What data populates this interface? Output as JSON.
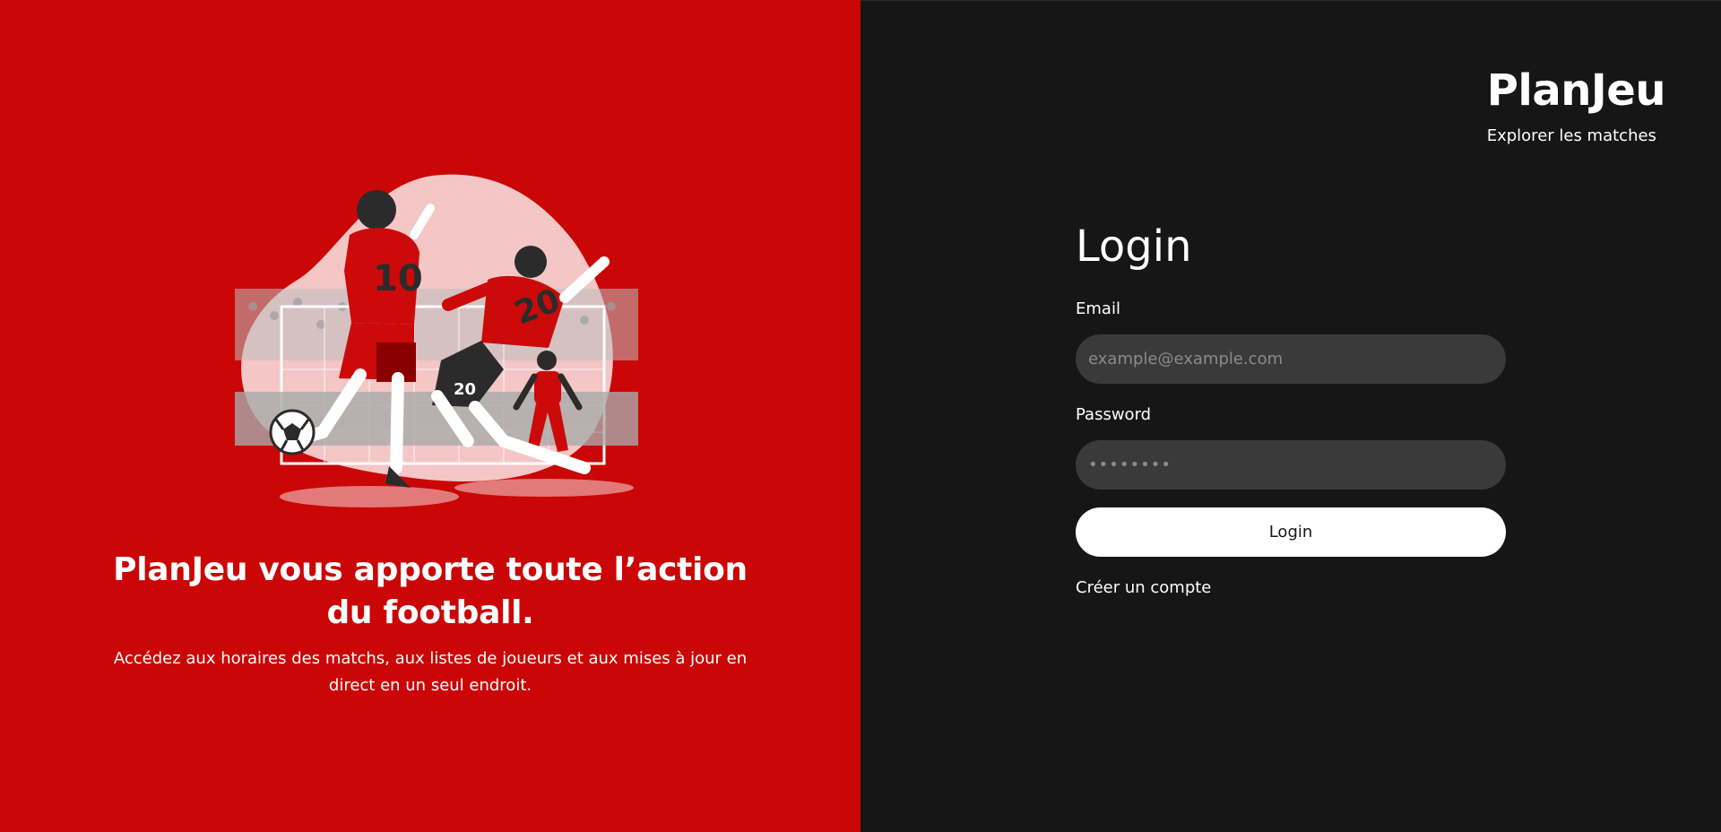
{
  "hero": {
    "title": "PlanJeu vous apporte toute l’action du football.",
    "subtitle": "Accédez aux horaires des matchs, aux listes de joueurs et aux mises à jour en direct en un seul endroit.",
    "illustration": {
      "jersey_numbers": [
        "10",
        "20",
        "20"
      ],
      "colors": {
        "background": "#cb0606",
        "blob": "#f4c6c6",
        "jersey": "#cc0a0a",
        "dark": "#2b2b2b"
      }
    }
  },
  "brand": {
    "name": "PlanJeu",
    "explore_link": "Explorer les matches"
  },
  "login": {
    "title": "Login",
    "email_label": "Email",
    "email_placeholder": "example@example.com",
    "password_label": "Password",
    "password_placeholder": "••••••••",
    "submit_label": "Login",
    "create_account_link": "Créer un compte"
  },
  "colors": {
    "accent_red": "#cb0606",
    "panel_bg": "#161616",
    "input_bg": "#3a3a3a",
    "button_bg": "#ffffff"
  }
}
